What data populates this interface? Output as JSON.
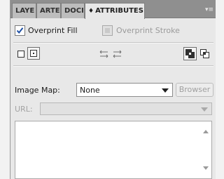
{
  "panel": {
    "tabs": [
      {
        "label": "LAYE"
      },
      {
        "label": "ARTE"
      },
      {
        "label": "DOCI"
      },
      {
        "label": "ATTRIBUTES",
        "prefix": "♦"
      }
    ],
    "menu_icon": "panel-menu-icon"
  },
  "overprint": {
    "fill_label": "Overprint Fill",
    "fill_checked": true,
    "stroke_label": "Overprint Stroke",
    "stroke_checked": false,
    "stroke_disabled": true
  },
  "icons": {
    "left": [
      "show-center-off-icon",
      "show-center-on-icon"
    ],
    "middle": [
      "reverse-path-direction-off-icon",
      "reverse-path-direction-on-icon"
    ],
    "right": [
      "use-non-zero-winding-fill-icon",
      "use-even-odd-fill-icon"
    ]
  },
  "image_map": {
    "label": "Image Map:",
    "value": "None",
    "browser_label": "Browser"
  },
  "url": {
    "label": "URL:",
    "value": ""
  },
  "notes": {
    "value": ""
  },
  "colors": {
    "tab_strip": "#8f8f8f",
    "panel_bg": "#e8e8e8",
    "check": "#1d4fa3"
  }
}
